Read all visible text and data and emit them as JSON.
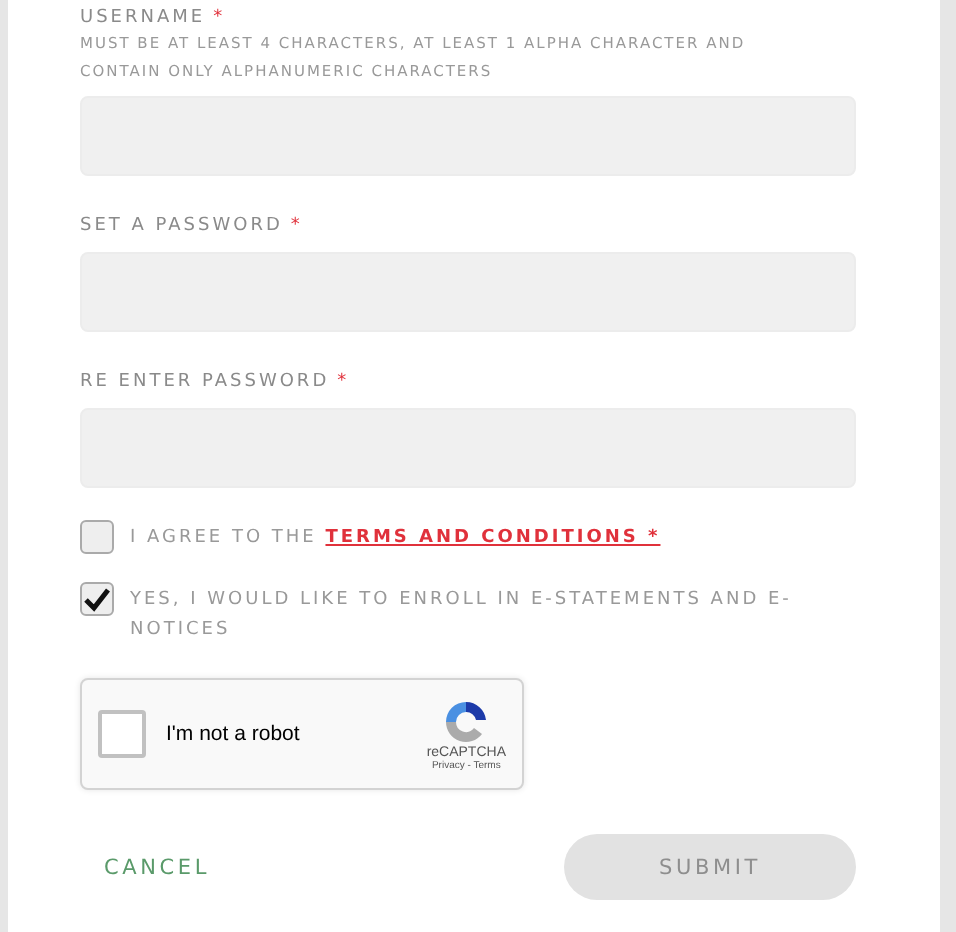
{
  "fields": [
    {
      "label": "USERNAME",
      "required": true,
      "hint": "MUST BE AT LEAST 4 CHARACTERS, AT LEAST 1 ALPHA CHARACTER AND CONTAIN ONLY ALPHANUMERIC CHARACTERS"
    },
    {
      "label": "SET A PASSWORD",
      "required": true
    },
    {
      "label": "RE ENTER PASSWORD",
      "required": true
    }
  ],
  "required_mark": "*",
  "checkboxes": [
    {
      "text": "I AGREE TO THE ",
      "link": "TERMS AND CONDITIONS *",
      "checked": false
    },
    {
      "text": "YES, I WOULD LIKE TO ENROLL IN E-STATEMENTS AND E-NOTICES",
      "checked": true
    }
  ],
  "captcha": {
    "label": "I'm not a robot",
    "checked": false,
    "brand": "reCAPTCHA",
    "links": "Privacy - Terms"
  },
  "cancel": "CANCEL",
  "submit": {
    "label": "SUBMIT",
    "disabled": true
  }
}
